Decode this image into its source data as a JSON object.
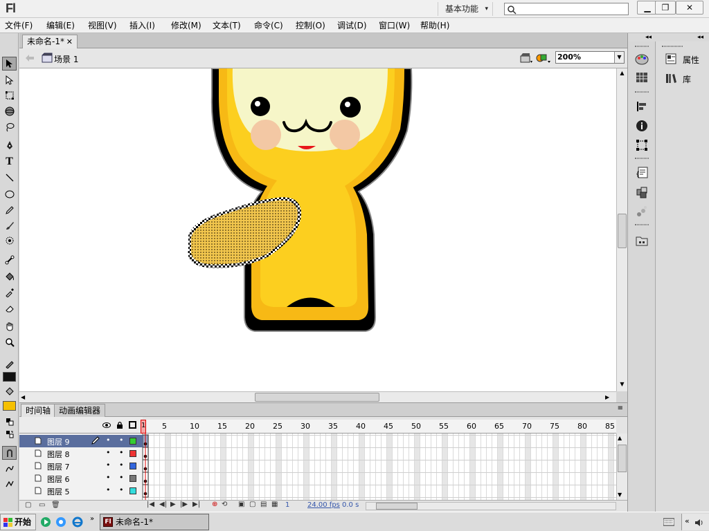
{
  "titlebar": {
    "logo": "Fl",
    "workspace": "基本功能",
    "search_placeholder": ""
  },
  "menu": [
    "文件(F)",
    "编辑(E)",
    "视图(V)",
    "插入(I)",
    "修改(M)",
    "文本(T)",
    "命令(C)",
    "控制(O)",
    "调试(D)",
    "窗口(W)",
    "帮助(H)"
  ],
  "document": {
    "tab_label": "未命名-1*",
    "scene_label": "场景 1",
    "zoom": "200%"
  },
  "timeline": {
    "tabs": [
      "时间轴",
      "动画编辑器"
    ],
    "layers": [
      {
        "name": "图层 9",
        "color": "#33cc33"
      },
      {
        "name": "图层 8",
        "color": "#ee3333"
      },
      {
        "name": "图层 7",
        "color": "#3366dd"
      },
      {
        "name": "图层 6",
        "color": "#777777"
      },
      {
        "name": "图层 5",
        "color": "#33dddd"
      }
    ],
    "frame_numbers": [
      "1",
      "5",
      "10",
      "15",
      "20",
      "25",
      "30",
      "35",
      "40",
      "45",
      "50",
      "55",
      "60",
      "65",
      "70",
      "75",
      "80",
      "85"
    ],
    "current_frame": "1",
    "fps": "24.00 fps",
    "time": "0.0 s"
  },
  "panels": {
    "properties": "属性",
    "library": "库"
  },
  "taskbar": {
    "start": "开始",
    "task_item": "未命名-1*"
  },
  "colors": {
    "stroke": "#111111",
    "fill": "#f5c000",
    "active_layer": "#5a6e9e"
  }
}
